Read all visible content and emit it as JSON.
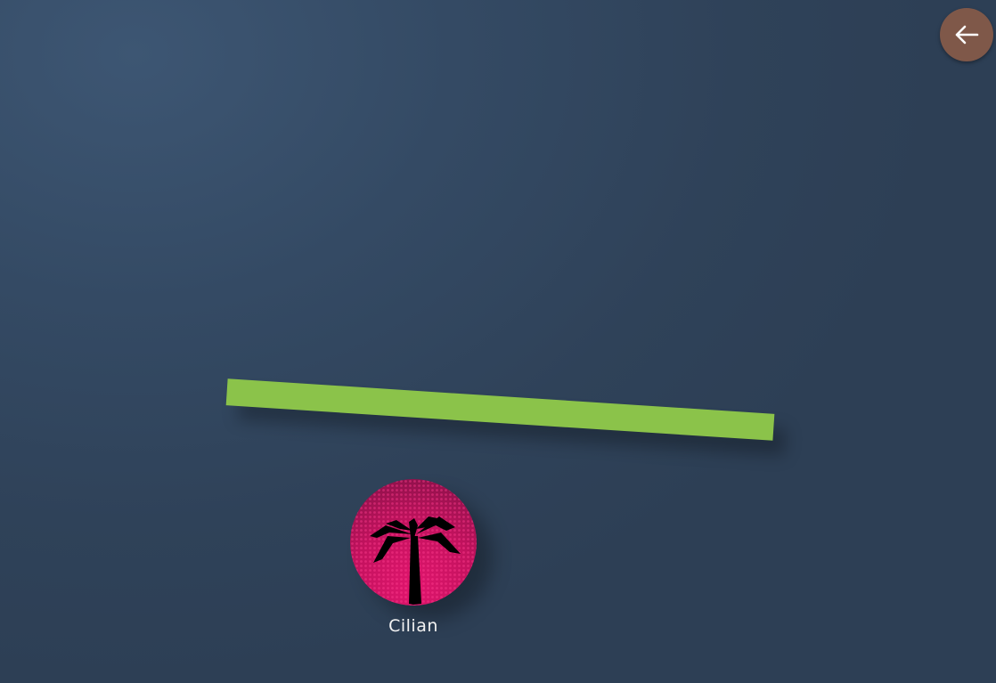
{
  "back_button": {
    "icon": "arrow-left-icon",
    "color": "#7f5849"
  },
  "plank": {
    "color": "#8bc34a"
  },
  "player": {
    "name": "Cilian",
    "avatar_icon": "palm-tree-icon",
    "avatar_colors": [
      "#8a1149",
      "#e0156d"
    ]
  }
}
